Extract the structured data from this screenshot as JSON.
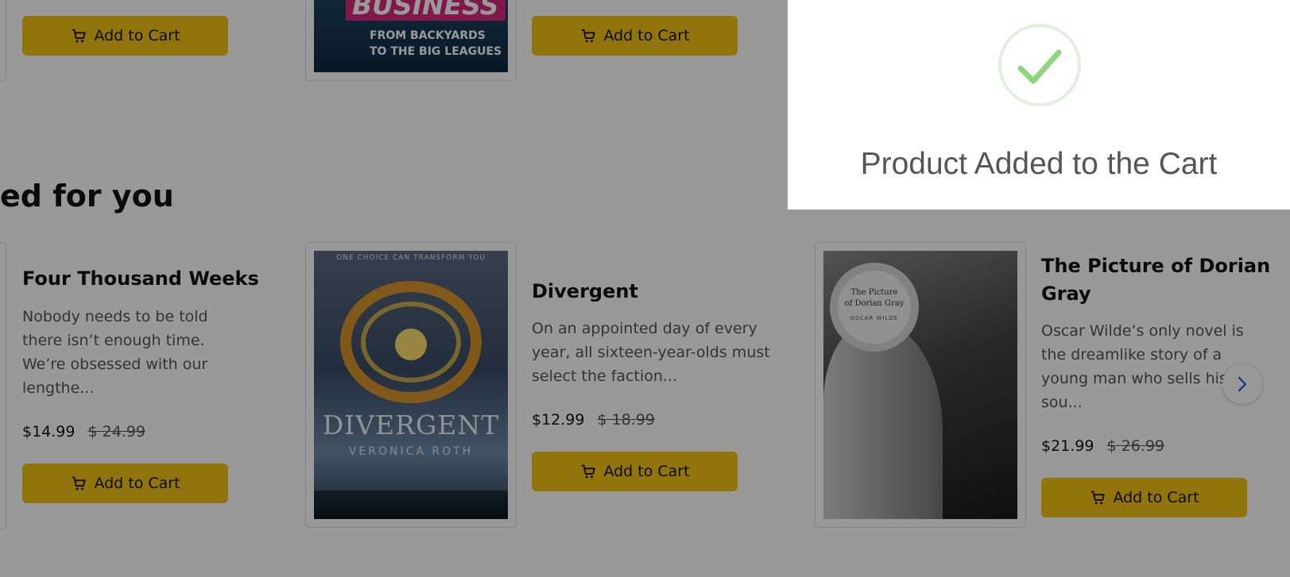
{
  "top_row": {
    "cart_label": "Add to Cart",
    "cover_text": {
      "line1": "BUSINESS",
      "line2": "FROM BACKYARDS",
      "line3": "TO THE BIG LEAGUES"
    }
  },
  "section": {
    "title": "ed for you"
  },
  "books": [
    {
      "title": "Four Thousand Weeks",
      "description": "Nobody needs to be told there isn’t enough time. We’re obsessed with our lengthe...",
      "price": "$14.99",
      "old_price": "$ 24.99",
      "cart_label": "Add to Cart"
    },
    {
      "title": "Divergent",
      "description": "On an appointed day of every year, all sixteen-year-olds must select the faction...",
      "price": "$12.99",
      "old_price": "$ 18.99",
      "cart_label": "Add to Cart",
      "cover": {
        "tagline": "ONE CHOICE CAN TRANSFORM YOU",
        "title": "DIVERGENT",
        "author": "VERONICA ROTH"
      }
    },
    {
      "title": "The Picture of Dorian Gray",
      "description": "Oscar Wilde’s only novel is the dreamlike story of a young man who sells his sou...",
      "price": "$21.99",
      "old_price": "$ 26.99",
      "cart_label": "Add to Cart",
      "cover": {
        "title_line1": "The Picture",
        "title_line2": "of Dorian Gray",
        "author": "OSCAR WILDE"
      }
    }
  ],
  "toast": {
    "message": "Product Added to the Cart"
  },
  "colors": {
    "accent": "#f2c314",
    "success": "#8ed67e",
    "overlay": "rgba(0,0,0,0.40)"
  },
  "icons": {
    "cart": "cart-icon",
    "next": "chevron-right-icon",
    "success": "check-icon"
  }
}
